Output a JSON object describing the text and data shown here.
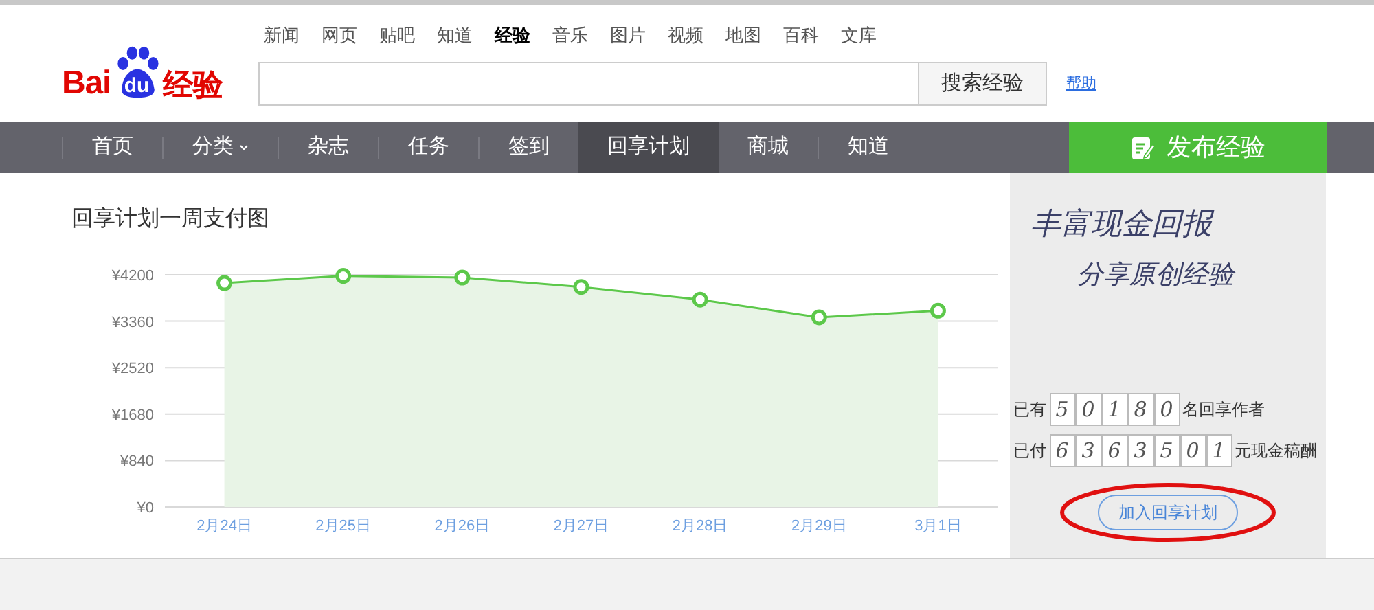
{
  "logo": {
    "left": "Bai",
    "badge": "du",
    "right": "经验"
  },
  "top_links": [
    {
      "label": "新闻",
      "selected": false
    },
    {
      "label": "网页",
      "selected": false
    },
    {
      "label": "贴吧",
      "selected": false
    },
    {
      "label": "知道",
      "selected": false
    },
    {
      "label": "经验",
      "selected": true
    },
    {
      "label": "音乐",
      "selected": false
    },
    {
      "label": "图片",
      "selected": false
    },
    {
      "label": "视频",
      "selected": false
    },
    {
      "label": "地图",
      "selected": false
    },
    {
      "label": "百科",
      "selected": false
    },
    {
      "label": "文库",
      "selected": false
    }
  ],
  "search": {
    "button": "搜索经验",
    "help": "帮助"
  },
  "nav": [
    {
      "label": "首页",
      "selected": false,
      "caret": false
    },
    {
      "label": "分类",
      "selected": false,
      "caret": true
    },
    {
      "label": "杂志",
      "selected": false,
      "caret": false
    },
    {
      "label": "任务",
      "selected": false,
      "caret": false
    },
    {
      "label": "签到",
      "selected": false,
      "caret": false
    },
    {
      "label": "回享计划",
      "selected": true,
      "caret": false
    },
    {
      "label": "商城",
      "selected": false,
      "caret": false
    },
    {
      "label": "知道",
      "selected": false,
      "caret": false
    }
  ],
  "publish_button": "发布经验",
  "chart": {
    "title": "回享计划一周支付图",
    "chart_data": {
      "type": "area",
      "categories": [
        "2月24日",
        "2月25日",
        "2月26日",
        "2月27日",
        "2月28日",
        "2月29日",
        "3月1日"
      ],
      "grid": true,
      "series": [
        {
          "color": "#5cc84a",
          "values": [
            4050,
            4180,
            4150,
            3980,
            3750,
            3430,
            3550
          ]
        }
      ],
      "ylim": [
        0,
        4200
      ],
      "yticks": [
        {
          "value": 0,
          "label": "¥0"
        },
        {
          "value": 840,
          "label": "¥840"
        },
        {
          "value": 1680,
          "label": "¥1680"
        },
        {
          "value": 2520,
          "label": "¥2520"
        },
        {
          "value": 3360,
          "label": "¥3360"
        },
        {
          "value": 4200,
          "label": "¥4200"
        }
      ]
    }
  },
  "promo": {
    "slogan_lines": [
      "丰富现金回报",
      "分享原创经验"
    ],
    "counters": [
      {
        "prefix": "已有",
        "digits": [
          "5",
          "0",
          "1",
          "8",
          "0"
        ],
        "suffix": "名回享作者"
      },
      {
        "prefix": "已付",
        "digits": [
          "6",
          "3",
          "6",
          "3",
          "5",
          "0",
          "1"
        ],
        "suffix": "元现金稿酬"
      }
    ],
    "join_button": "加入回享计划"
  }
}
